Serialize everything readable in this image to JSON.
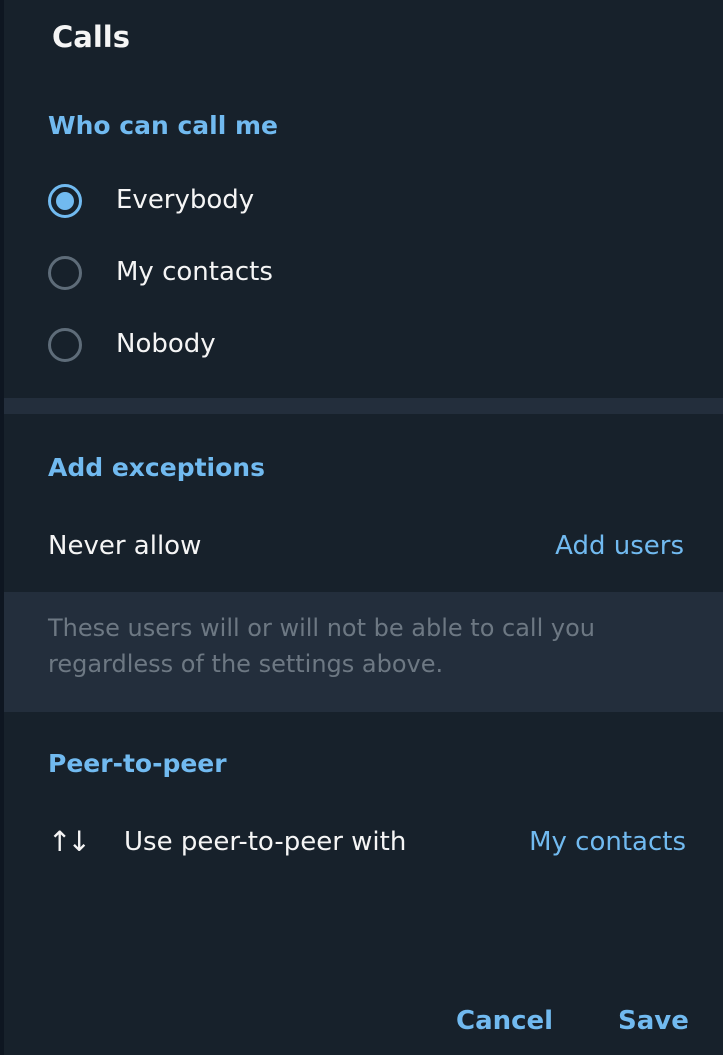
{
  "dialog": {
    "title": "Calls"
  },
  "who_can_call": {
    "header": "Who can call me",
    "options": [
      {
        "label": "Everybody",
        "selected": true
      },
      {
        "label": "My contacts",
        "selected": false
      },
      {
        "label": "Nobody",
        "selected": false
      }
    ]
  },
  "exceptions": {
    "header": "Add exceptions",
    "never_allow_label": "Never allow",
    "add_users_label": "Add users",
    "note": "These users will or will not be able to call you regardless of the settings above."
  },
  "p2p": {
    "header": "Peer-to-peer",
    "icon": "↑↓",
    "label": "Use peer-to-peer with",
    "value": "My contacts"
  },
  "footer": {
    "cancel_label": "Cancel",
    "save_label": "Save"
  },
  "colors": {
    "background": "#17212b",
    "accent": "#71baf0",
    "band": "#232e3c",
    "text": "#f5f5f5",
    "muted": "#6d7883"
  }
}
